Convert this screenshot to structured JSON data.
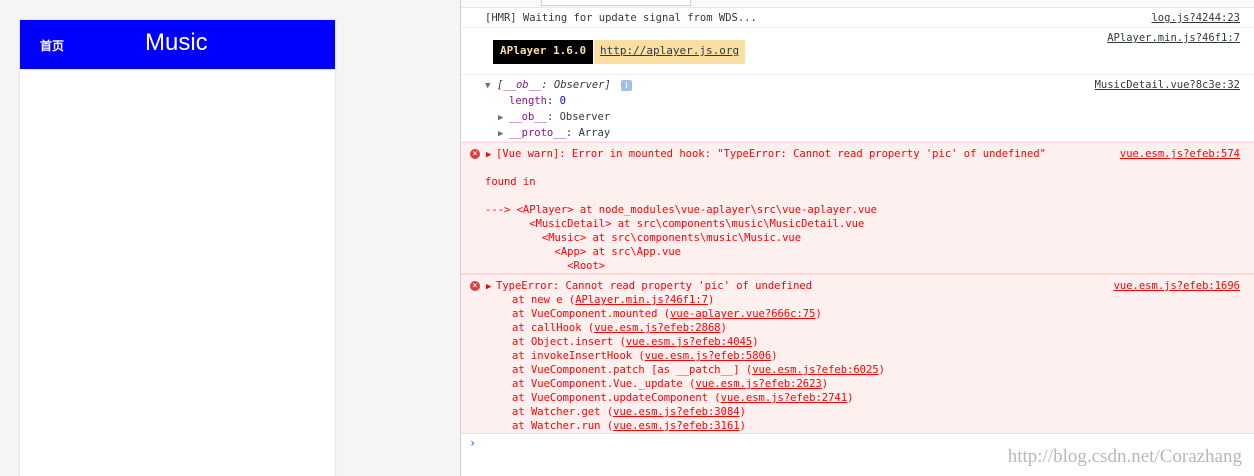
{
  "app": {
    "home_label": "首页",
    "title": "Music",
    "header_color": "#0000ff"
  },
  "console": {
    "hmr": {
      "text": "[HMR] Waiting for update signal from WDS...",
      "source": "log.js?4244:23"
    },
    "aplayer": {
      "badge": "APlayer 1.6.0",
      "link": "http://aplayer.js.org",
      "source": "APlayer.min.js?46f1:7"
    },
    "observer": {
      "summary_key": "__ob__",
      "summary_value": "Observer]",
      "summary_open": "[",
      "source": "MusicDetail.vue?8c3e:32",
      "length_key": "length",
      "length_value": "0",
      "ob_key": "__ob__",
      "ob_value": "Observer",
      "proto_key": "__proto__",
      "proto_value": "Array"
    },
    "error1": {
      "message": "[Vue warn]: Error in mounted hook: \"TypeError: Cannot read property 'pic' of undefined\"",
      "source": "vue.esm.js?efeb:574",
      "found_in": "found in",
      "trace": [
        "---> <APlayer> at node_modules\\vue-aplayer\\src\\vue-aplayer.vue",
        "       <MusicDetail> at src\\components\\music\\MusicDetail.vue",
        "         <Music> at src\\components\\music\\Music.vue",
        "           <App> at src\\App.vue",
        "             <Root>"
      ]
    },
    "error2": {
      "message": "TypeError: Cannot read property 'pic' of undefined",
      "source": "vue.esm.js?efeb:1696",
      "stack": [
        {
          "prefix": "at new e (",
          "link": "APlayer.min.js?46f1:7"
        },
        {
          "prefix": "at VueComponent.mounted (",
          "link": "vue-aplayer.vue?666c:75"
        },
        {
          "prefix": "at callHook (",
          "link": "vue.esm.js?efeb:2868"
        },
        {
          "prefix": "at Object.insert (",
          "link": "vue.esm.js?efeb:4045"
        },
        {
          "prefix": "at invokeInsertHook (",
          "link": "vue.esm.js?efeb:5806"
        },
        {
          "prefix": "at VueComponent.patch [as __patch__] (",
          "link": "vue.esm.js?efeb:6025"
        },
        {
          "prefix": "at VueComponent.Vue._update (",
          "link": "vue.esm.js?efeb:2623"
        },
        {
          "prefix": "at VueComponent.updateComponent (",
          "link": "vue.esm.js?efeb:2741"
        },
        {
          "prefix": "at Watcher.get (",
          "link": "vue.esm.js?efeb:3084"
        },
        {
          "prefix": "at Watcher.run (",
          "link": "vue.esm.js?efeb:3161"
        }
      ]
    },
    "prompt_glyph": "›",
    "watermark": "http://blog.csdn.net/Corazhang"
  }
}
